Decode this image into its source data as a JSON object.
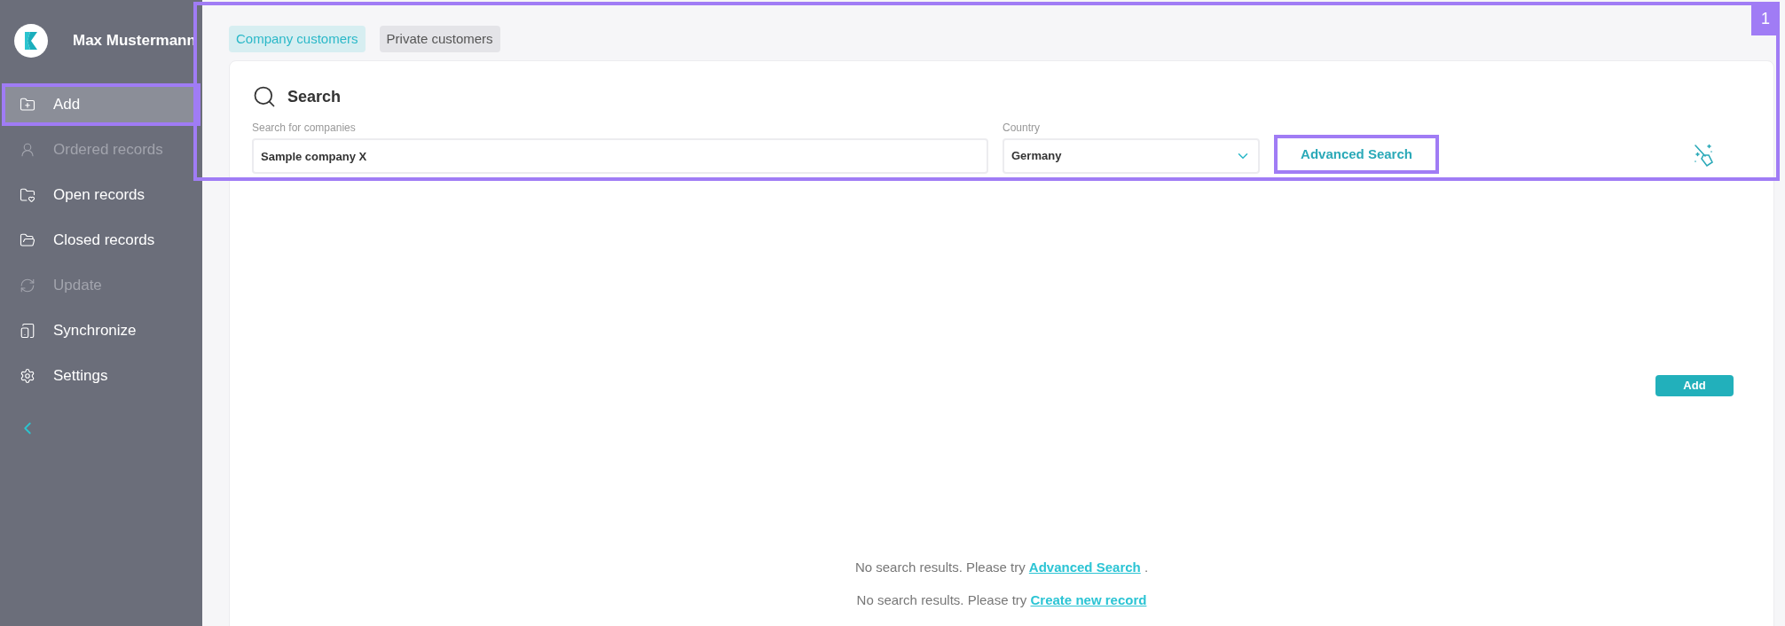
{
  "sidebar": {
    "user_name": "Max Mustermann",
    "items": [
      {
        "label": "Add",
        "selected": true,
        "disabled": false,
        "highlighted": true
      },
      {
        "label": "Ordered records",
        "selected": false,
        "disabled": true,
        "highlighted": false
      },
      {
        "label": "Open records",
        "selected": false,
        "disabled": false,
        "highlighted": false
      },
      {
        "label": "Closed records",
        "selected": false,
        "disabled": false,
        "highlighted": false
      },
      {
        "label": "Update",
        "selected": false,
        "disabled": true,
        "highlighted": false
      },
      {
        "label": "Synchronize",
        "selected": false,
        "disabled": false,
        "highlighted": false
      },
      {
        "label": "Settings",
        "selected": false,
        "disabled": false,
        "highlighted": false
      }
    ]
  },
  "annotation": {
    "label": "1"
  },
  "tabs": [
    {
      "label": "Company customers",
      "selected": true
    },
    {
      "label": "Private customers",
      "selected": false
    }
  ],
  "search": {
    "title": "Search",
    "company_field": {
      "label": "Search for companies",
      "value": "Sample company X"
    },
    "country_field": {
      "label": "Country",
      "value": "Germany"
    },
    "advanced_search": {
      "label": "Advanced Search",
      "highlighted": true
    }
  },
  "add_button": "Add",
  "messages": [
    {
      "text": "No search results. Please try",
      "link": "Advanced Search",
      "suffix": "."
    },
    {
      "text": "No search results. Please try",
      "link": "Create new record"
    }
  ]
}
